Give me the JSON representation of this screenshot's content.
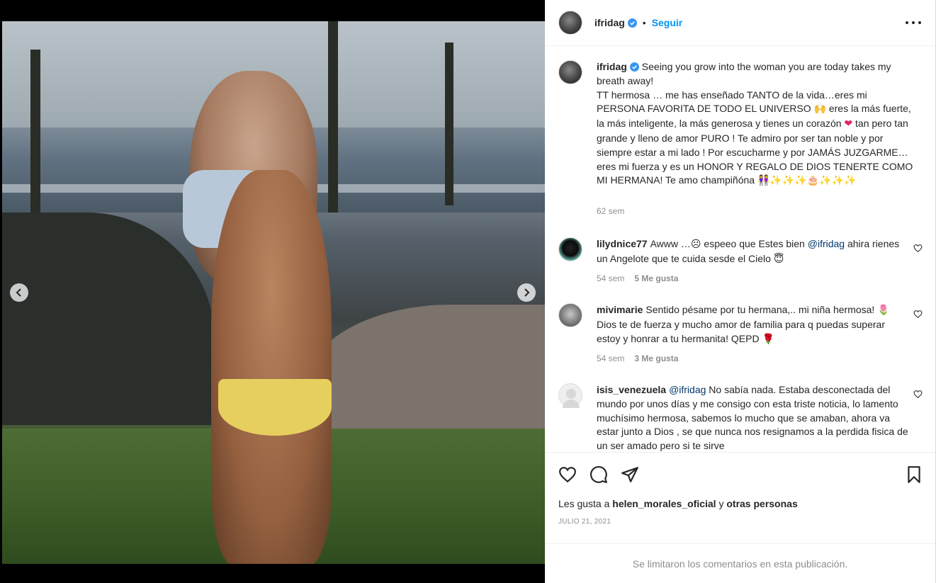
{
  "post": {
    "username": "ifridag",
    "separator": "•",
    "follow_label": "Seguir",
    "caption": {
      "line1": "Seeing you grow into the woman you are today takes my breath away!",
      "line2": "TT hermosa … me has enseñado TANTO de la vida…eres mi PERSONA FAVORITA DE TODO EL UNIVERSO",
      "emoji1": "🙌",
      "line3": " eres la más fuerte, la más inteligente, la más generosa y tienes un corazón ",
      "emoji2": "❤",
      "line4": " tan pero tan grande y lleno de amor PURO ! Te admiro por ser tan noble y por siempre estar a mi lado ! Por escucharme y por JAMÁS JUZGARME… eres mi fuerza y es un HONOR Y REGALO DE DIOS TENERTE COMO MI HERMANA! Te amo champiñóna ",
      "emoji3": "👭✨✨✨🎂✨✨✨",
      "time": "62 sem"
    }
  },
  "comments": [
    {
      "user": "lilydnice77",
      "text_a": "Awww …",
      "emoji_a": "☹",
      "text_b": " espeeo que Estes bien ",
      "mention": "@ifridag",
      "text_c": " ahira rienes un Angelote que te cuida sesde el Cielo ",
      "emoji_b": "😇",
      "time": "54 sem",
      "likes": "5 Me gusta"
    },
    {
      "user": "mivimarie",
      "text_a": "Sentido pésame por tu hermana,.. mi niña hermosa! ",
      "emoji_a": "🌷",
      "text_b": "Dios te de fuerza y mucho amor de familia para q puedas superar estoy y honrar a tu hermanita! QEPD ",
      "emoji_b": "🌹",
      "time": "54 sem",
      "likes": "3 Me gusta"
    },
    {
      "user": "isis_venezuela",
      "mention": "@ifridag",
      "text_a": " No sabía nada. Estaba desconectada del mundo por unos días y me consigo con esta triste noticia, lo lamento muchísimo hermosa, sabemos lo mucho que se amaban, ahora va estar junto a Dios , se que nunca nos resignamos a la perdida fisica de un ser amado pero si te sirve"
    }
  ],
  "actions": {
    "likes_prefix": "Les gusta a ",
    "likes_user": "helen_morales_oficial",
    "likes_mid": " y ",
    "likes_others": "otras personas",
    "date": "JULIO 21, 2021",
    "limited_notice": "Se limitaron los comentarios en esta publicación."
  },
  "carousel": {
    "dots_total": 5,
    "active_index": 1
  },
  "icons": {
    "prev": "chevron-left-icon",
    "next": "chevron-right-icon",
    "like": "heart-icon",
    "comment": "comment-icon",
    "share": "paper-plane-icon",
    "save": "bookmark-icon",
    "more": "more-horizontal-icon",
    "verified": "verified-badge-icon"
  },
  "colors": {
    "accent": "#0095f6",
    "verified": "#3897f0",
    "mention": "#00376b",
    "muted": "#8e8e8e"
  }
}
